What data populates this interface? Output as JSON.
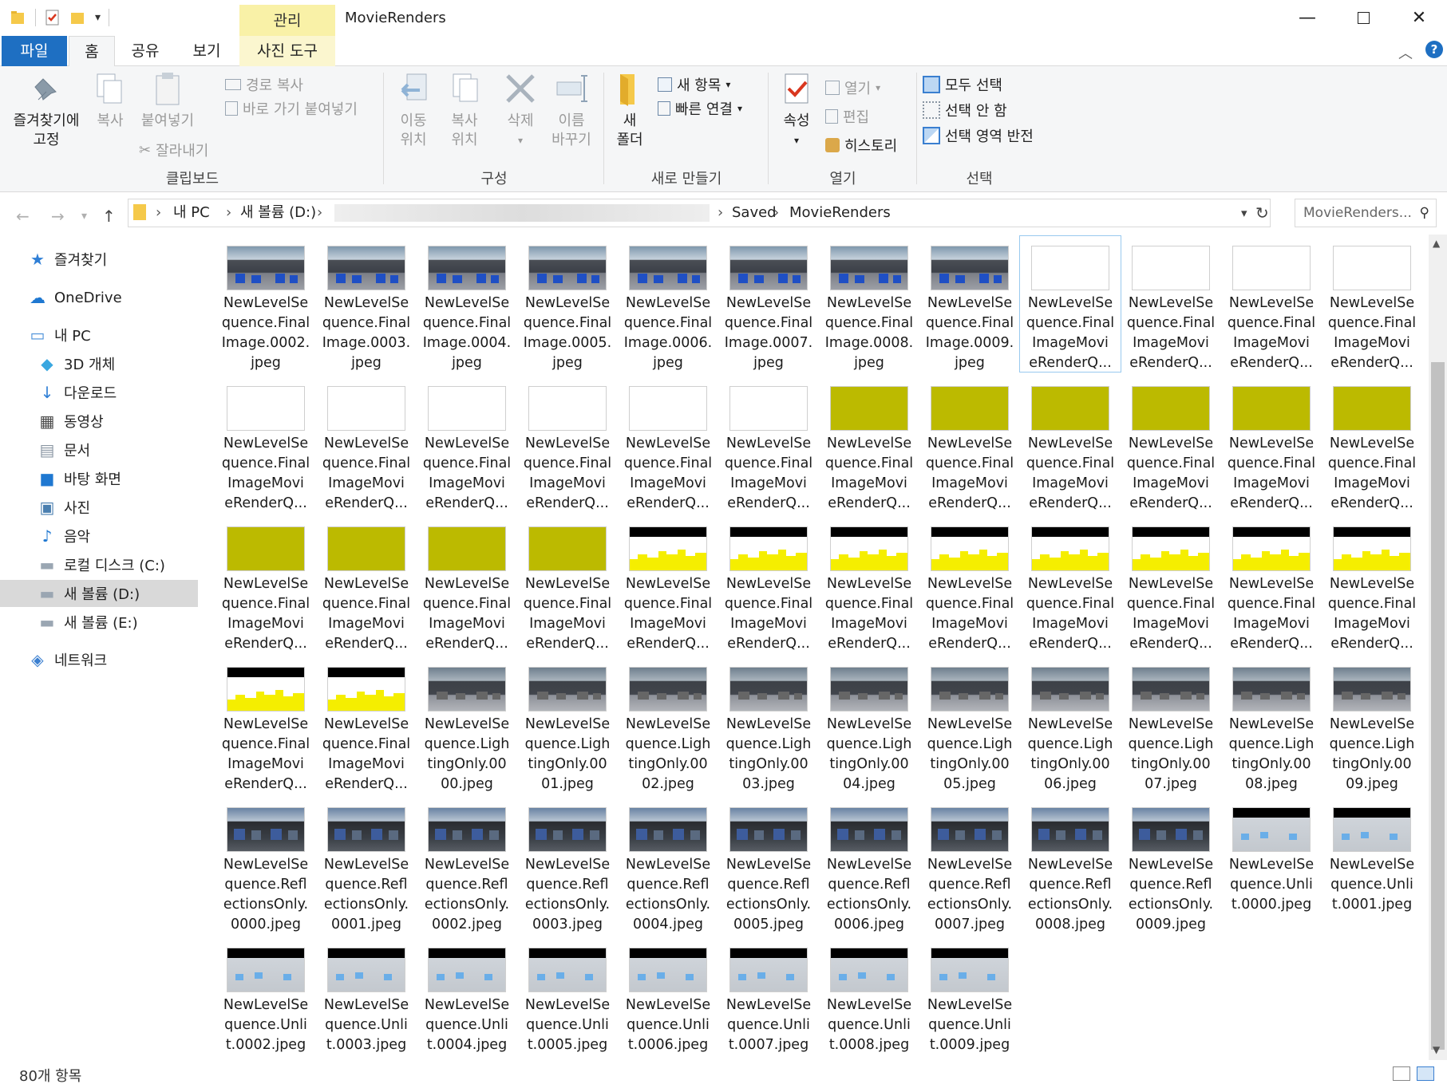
{
  "window": {
    "title": "MovieRenders",
    "manage_label": "관리"
  },
  "tabs": {
    "file": "파일",
    "home": "홈",
    "share": "공유",
    "view": "보기",
    "photo_tools": "사진 도구"
  },
  "ribbon": {
    "clipboard": {
      "pin_line1": "즐겨찾기에",
      "pin_line2": "고정",
      "copy": "복사",
      "paste": "붙여넣기",
      "copy_path": "경로 복사",
      "paste_shortcut": "바로 가기 붙여넣기",
      "cut": "잘라내기",
      "group": "클립보드"
    },
    "organize": {
      "move_line1": "이동",
      "move_line2": "위치",
      "copy_line1": "복사",
      "copy_line2": "위치",
      "delete": "삭제",
      "rename_line1": "이름",
      "rename_line2": "바꾸기",
      "group": "구성"
    },
    "new": {
      "new_folder_line1": "새",
      "new_folder_line2": "폴더",
      "new_item": "새 항목",
      "easy_access": "빠른 연결",
      "group": "새로 만들기"
    },
    "open": {
      "properties": "속성",
      "open": "열기",
      "edit": "편집",
      "history": "히스토리",
      "group": "열기"
    },
    "select": {
      "select_all": "모두 선택",
      "select_none": "선택 안 함",
      "invert": "선택 영역 반전",
      "group": "선택"
    }
  },
  "address": {
    "crumbs": [
      "내 PC",
      "새 볼륨 (D:)",
      "Saved",
      "MovieRenders"
    ],
    "search_placeholder": "MovieRenders..."
  },
  "nav": {
    "items": [
      {
        "label": "즐겨찾기",
        "icon": "star-icon"
      },
      {
        "label": "OneDrive",
        "icon": "cloud-icon"
      },
      {
        "label": "내 PC",
        "icon": "pc-icon"
      },
      {
        "label": "3D 개체",
        "icon": "cube-icon"
      },
      {
        "label": "다운로드",
        "icon": "download-icon"
      },
      {
        "label": "동영상",
        "icon": "film-icon"
      },
      {
        "label": "문서",
        "icon": "document-icon"
      },
      {
        "label": "바탕 화면",
        "icon": "desktop-icon"
      },
      {
        "label": "사진",
        "icon": "picture-icon"
      },
      {
        "label": "음악",
        "icon": "music-icon"
      },
      {
        "label": "로컬 디스크 (C:)",
        "icon": "drive-icon"
      },
      {
        "label": "새 볼륨 (D:)",
        "icon": "drive-icon"
      },
      {
        "label": "새 볼륨 (E:)",
        "icon": "drive-icon"
      },
      {
        "label": "네트워크",
        "icon": "network-icon"
      }
    ]
  },
  "files": [
    {
      "name": "NewLevelSe\nquence.Final\nImage.0002.\njpeg",
      "thumb": "sky"
    },
    {
      "name": "NewLevelSe\nquence.Final\nImage.0003.\njpeg",
      "thumb": "sky"
    },
    {
      "name": "NewLevelSe\nquence.Final\nImage.0004.\njpeg",
      "thumb": "sky"
    },
    {
      "name": "NewLevelSe\nquence.Final\nImage.0005.\njpeg",
      "thumb": "sky"
    },
    {
      "name": "NewLevelSe\nquence.Final\nImage.0006.\njpeg",
      "thumb": "sky"
    },
    {
      "name": "NewLevelSe\nquence.Final\nImage.0007.\njpeg",
      "thumb": "sky"
    },
    {
      "name": "NewLevelSe\nquence.Final\nImage.0008.\njpeg",
      "thumb": "sky"
    },
    {
      "name": "NewLevelSe\nquence.Final\nImage.0009.\njpeg",
      "thumb": "sky"
    },
    {
      "name": "NewLevelSe\nquence.Final\nImageMovi\neRenderQ...",
      "thumb": "white"
    },
    {
      "name": "NewLevelSe\nquence.Final\nImageMovi\neRenderQ...",
      "thumb": "white"
    },
    {
      "name": "NewLevelSe\nquence.Final\nImageMovi\neRenderQ...",
      "thumb": "white"
    },
    {
      "name": "NewLevelSe\nquence.Final\nImageMovi\neRenderQ...",
      "thumb": "white"
    },
    {
      "name": "NewLevelSe\nquence.Final\nImageMovi\neRenderQ...",
      "thumb": "white"
    },
    {
      "name": "NewLevelSe\nquence.Final\nImageMovi\neRenderQ...",
      "thumb": "white"
    },
    {
      "name": "NewLevelSe\nquence.Final\nImageMovi\neRenderQ...",
      "thumb": "white"
    },
    {
      "name": "NewLevelSe\nquence.Final\nImageMovi\neRenderQ...",
      "thumb": "white"
    },
    {
      "name": "NewLevelSe\nquence.Final\nImageMovi\neRenderQ...",
      "thumb": "white"
    },
    {
      "name": "NewLevelSe\nquence.Final\nImageMovi\neRenderQ...",
      "thumb": "white"
    },
    {
      "name": "NewLevelSe\nquence.Final\nImageMovi\neRenderQ...",
      "thumb": "olive"
    },
    {
      "name": "NewLevelSe\nquence.Final\nImageMovi\neRenderQ...",
      "thumb": "olive"
    },
    {
      "name": "NewLevelSe\nquence.Final\nImageMovi\neRenderQ...",
      "thumb": "olive"
    },
    {
      "name": "NewLevelSe\nquence.Final\nImageMovi\neRenderQ...",
      "thumb": "olive"
    },
    {
      "name": "NewLevelSe\nquence.Final\nImageMovi\neRenderQ...",
      "thumb": "olive"
    },
    {
      "name": "NewLevelSe\nquence.Final\nImageMovi\neRenderQ...",
      "thumb": "olive"
    },
    {
      "name": "NewLevelSe\nquence.Final\nImageMovi\neRenderQ...",
      "thumb": "olive"
    },
    {
      "name": "NewLevelSe\nquence.Final\nImageMovi\neRenderQ...",
      "thumb": "olive"
    },
    {
      "name": "NewLevelSe\nquence.Final\nImageMovi\neRenderQ...",
      "thumb": "olive"
    },
    {
      "name": "NewLevelSe\nquence.Final\nImageMovi\neRenderQ...",
      "thumb": "olive"
    },
    {
      "name": "NewLevelSe\nquence.Final\nImageMovi\neRenderQ...",
      "thumb": "yellow"
    },
    {
      "name": "NewLevelSe\nquence.Final\nImageMovi\neRenderQ...",
      "thumb": "yellow"
    },
    {
      "name": "NewLevelSe\nquence.Final\nImageMovi\neRenderQ...",
      "thumb": "yellow"
    },
    {
      "name": "NewLevelSe\nquence.Final\nImageMovi\neRenderQ...",
      "thumb": "yellow"
    },
    {
      "name": "NewLevelSe\nquence.Final\nImageMovi\neRenderQ...",
      "thumb": "yellow"
    },
    {
      "name": "NewLevelSe\nquence.Final\nImageMovi\neRenderQ...",
      "thumb": "yellow"
    },
    {
      "name": "NewLevelSe\nquence.Final\nImageMovi\neRenderQ...",
      "thumb": "yellow"
    },
    {
      "name": "NewLevelSe\nquence.Final\nImageMovi\neRenderQ...",
      "thumb": "yellow"
    },
    {
      "name": "NewLevelSe\nquence.Final\nImageMovi\neRenderQ...",
      "thumb": "yellow"
    },
    {
      "name": "NewLevelSe\nquence.Final\nImageMovi\neRenderQ...",
      "thumb": "yellow"
    },
    {
      "name": "NewLevelSe\nquence.Ligh\ntingOnly.00\n00.jpeg",
      "thumb": "light"
    },
    {
      "name": "NewLevelSe\nquence.Ligh\ntingOnly.00\n01.jpeg",
      "thumb": "light"
    },
    {
      "name": "NewLevelSe\nquence.Ligh\ntingOnly.00\n02.jpeg",
      "thumb": "light"
    },
    {
      "name": "NewLevelSe\nquence.Ligh\ntingOnly.00\n03.jpeg",
      "thumb": "light"
    },
    {
      "name": "NewLevelSe\nquence.Ligh\ntingOnly.00\n04.jpeg",
      "thumb": "light"
    },
    {
      "name": "NewLevelSe\nquence.Ligh\ntingOnly.00\n05.jpeg",
      "thumb": "light"
    },
    {
      "name": "NewLevelSe\nquence.Ligh\ntingOnly.00\n06.jpeg",
      "thumb": "light"
    },
    {
      "name": "NewLevelSe\nquence.Ligh\ntingOnly.00\n07.jpeg",
      "thumb": "light"
    },
    {
      "name": "NewLevelSe\nquence.Ligh\ntingOnly.00\n08.jpeg",
      "thumb": "light"
    },
    {
      "name": "NewLevelSe\nquence.Ligh\ntingOnly.00\n09.jpeg",
      "thumb": "light"
    },
    {
      "name": "NewLevelSe\nquence.Refl\nectionsOnly.\n0000.jpeg",
      "thumb": "refl"
    },
    {
      "name": "NewLevelSe\nquence.Refl\nectionsOnly.\n0001.jpeg",
      "thumb": "refl"
    },
    {
      "name": "NewLevelSe\nquence.Refl\nectionsOnly.\n0002.jpeg",
      "thumb": "refl"
    },
    {
      "name": "NewLevelSe\nquence.Refl\nectionsOnly.\n0003.jpeg",
      "thumb": "refl"
    },
    {
      "name": "NewLevelSe\nquence.Refl\nectionsOnly.\n0004.jpeg",
      "thumb": "refl"
    },
    {
      "name": "NewLevelSe\nquence.Refl\nectionsOnly.\n0005.jpeg",
      "thumb": "refl"
    },
    {
      "name": "NewLevelSe\nquence.Refl\nectionsOnly.\n0006.jpeg",
      "thumb": "refl"
    },
    {
      "name": "NewLevelSe\nquence.Refl\nectionsOnly.\n0007.jpeg",
      "thumb": "refl"
    },
    {
      "name": "NewLevelSe\nquence.Refl\nectionsOnly.\n0008.jpeg",
      "thumb": "refl"
    },
    {
      "name": "NewLevelSe\nquence.Refl\nectionsOnly.\n0009.jpeg",
      "thumb": "refl"
    },
    {
      "name": "NewLevelSe\nquence.Unli\nt.0000.jpeg",
      "thumb": "unlit"
    },
    {
      "name": "NewLevelSe\nquence.Unli\nt.0001.jpeg",
      "thumb": "unlit"
    },
    {
      "name": "NewLevelSe\nquence.Unli\nt.0002.jpeg",
      "thumb": "unlit"
    },
    {
      "name": "NewLevelSe\nquence.Unli\nt.0003.jpeg",
      "thumb": "unlit"
    },
    {
      "name": "NewLevelSe\nquence.Unli\nt.0004.jpeg",
      "thumb": "unlit"
    },
    {
      "name": "NewLevelSe\nquence.Unli\nt.0005.jpeg",
      "thumb": "unlit"
    },
    {
      "name": "NewLevelSe\nquence.Unli\nt.0006.jpeg",
      "thumb": "unlit"
    },
    {
      "name": "NewLevelSe\nquence.Unli\nt.0007.jpeg",
      "thumb": "unlit"
    },
    {
      "name": "NewLevelSe\nquence.Unli\nt.0008.jpeg",
      "thumb": "unlit"
    },
    {
      "name": "NewLevelSe\nquence.Unli\nt.0009.jpeg",
      "thumb": "unlit"
    }
  ],
  "status": {
    "count": "80개 항목"
  },
  "colors": {
    "accent": "#1e6fc2",
    "manage_tab": "#f9f1a7",
    "olive_thumb": "#bcba00"
  }
}
